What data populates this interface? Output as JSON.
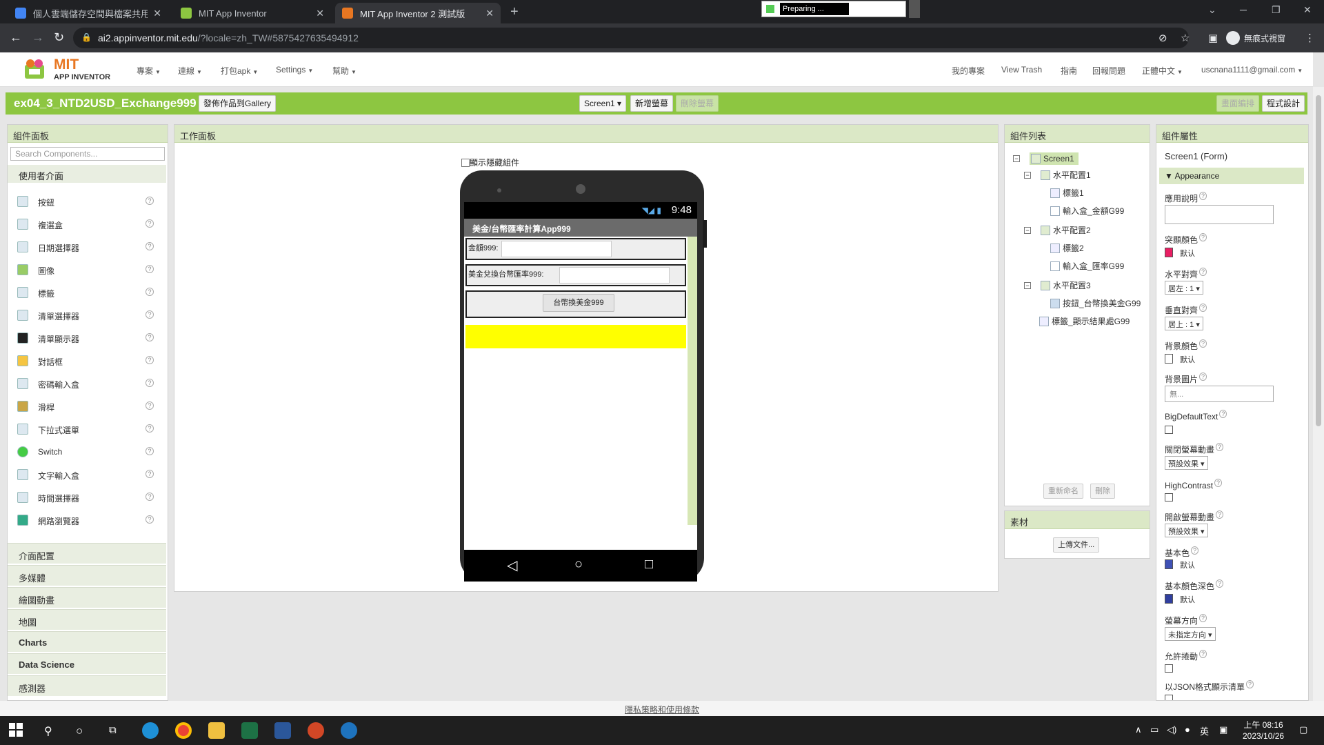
{
  "browser": {
    "tabs": [
      {
        "title": "個人雲端儲存空間與檔案共用平",
        "favicon_color": "#4285f4"
      },
      {
        "title": "MIT App Inventor",
        "favicon_color": "#8dc641"
      },
      {
        "title": "MIT App Inventor 2 測試版",
        "favicon_color": "#e87722"
      }
    ],
    "preparing": "Preparing ...",
    "url_host": "ai2.appinventor.mit.edu",
    "url_path": "/?locale=zh_TW#5875427635494912",
    "incognito_label": "無痕式視窗"
  },
  "ai_header": {
    "logo_text": "MIT",
    "logo_sub": "APP INVENTOR",
    "left_menus": [
      "專案",
      "連線",
      "打包apk",
      "Settings",
      "幫助"
    ],
    "right_links": [
      "我的專案",
      "View Trash",
      "指南",
      "回報問題",
      "正體中文",
      "uscnana1111@gmail.com"
    ]
  },
  "project": {
    "name": "ex04_3_NTD2USD_Exchange999",
    "gallery_button": "發佈作品到Gallery",
    "screen_select": "Screen1",
    "add_screen": "新增螢幕",
    "remove_screen": "刪除螢幕",
    "designer_button": "畫面編排",
    "blocks_button": "程式設計"
  },
  "palette": {
    "header": "組件面板",
    "search_placeholder": "Search Components...",
    "ui_category": "使用者介面",
    "items": [
      "按鈕",
      "複選盒",
      "日期選擇器",
      "圖像",
      "標籤",
      "清單選擇器",
      "清單顯示器",
      "對話框",
      "密碼輸入盒",
      "滑桿",
      "下拉式選單",
      "Switch",
      "文字輸入盒",
      "時間選擇器",
      "網路瀏覽器"
    ],
    "categories": [
      "介面配置",
      "多媒體",
      "繪圖動畫",
      "地圖",
      "Charts",
      "Data Science",
      "感測器"
    ]
  },
  "viewer": {
    "header": "工作面板",
    "show_hidden": "顯示隱藏組件",
    "phone_time": "9:48",
    "app_title": "美金/台幣匯率計算App999",
    "label1": "金額999:",
    "label2": "美金兌換台幣匯率999:",
    "button": "台幣換美金999"
  },
  "components": {
    "header": "組件列表",
    "tree": [
      "Screen1",
      "水平配置1",
      "標籤1",
      "輸入盒_金額G99",
      "水平配置2",
      "標籤2",
      "輸入盒_匯率G99",
      "水平配置3",
      "按鈕_台幣換美金G99",
      "標籤_顯示結果處G99"
    ],
    "rename": "重新命名",
    "delete": "刪除",
    "media_header": "素材",
    "upload": "上傳文件..."
  },
  "properties": {
    "header": "組件屬性",
    "component": "Screen1 (Form)",
    "section": "Appearance",
    "about": "應用說明",
    "accent_color": "突顯顏色",
    "accent_value": "默认",
    "align_h": "水平對齊",
    "align_h_value": "居左 : 1",
    "align_v": "垂直對齊",
    "align_v_value": "居上 : 1",
    "bg_color": "背景顏色",
    "bg_value": "默认",
    "bg_image": "背景圖片",
    "bg_image_value": "無...",
    "big_text": "BigDefaultText",
    "close_anim": "關閉螢幕動畫",
    "close_anim_value": "預設效果",
    "high_contrast": "HighContrast",
    "open_anim": "開啟螢幕動畫",
    "open_anim_value": "預設效果",
    "primary": "基本色",
    "primary_value": "默认",
    "primary_dark": "基本顏色深色",
    "primary_dark_value": "默认",
    "orientation": "螢幕方向",
    "orientation_value": "未指定方向",
    "scrollable": "允許捲動",
    "json_list": "以JSON格式顯示清單",
    "colors": {
      "accent": "#e91e63",
      "bg": "#ffffff",
      "primary": "#3f51b5",
      "primary_dark": "#303f9f"
    }
  },
  "footer": "隱私策略和使用條款",
  "taskbar": {
    "time": "上午 08:16",
    "date": "2023/10/26",
    "ime": "英"
  }
}
